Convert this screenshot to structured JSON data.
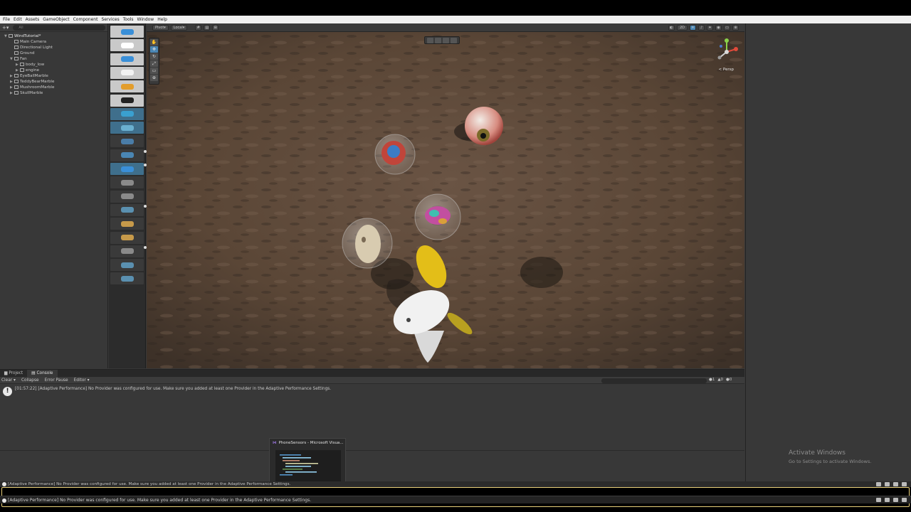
{
  "menu": [
    "File",
    "Edit",
    "Assets",
    "GameObject",
    "Component",
    "Services",
    "Tools",
    "Window",
    "Help"
  ],
  "hierarchy": {
    "search_placeholder": "All",
    "items": [
      {
        "label": "WindTutorial*",
        "depth": 0,
        "expand": "▼",
        "scene": true
      },
      {
        "label": "Main Camera",
        "depth": 1,
        "expand": ""
      },
      {
        "label": "Directional Light",
        "depth": 1,
        "expand": ""
      },
      {
        "label": "Ground",
        "depth": 1,
        "expand": ""
      },
      {
        "label": "Fan",
        "depth": 1,
        "expand": "▼"
      },
      {
        "label": "body_low",
        "depth": 2,
        "expand": "▶"
      },
      {
        "label": "engine",
        "depth": 2,
        "expand": "▶"
      },
      {
        "label": "EyeBallMarble",
        "depth": 1,
        "expand": "▶"
      },
      {
        "label": "TeddyBearMarble",
        "depth": 1,
        "expand": "▶"
      },
      {
        "label": "MushroomMarble",
        "depth": 1,
        "expand": "▶"
      },
      {
        "label": "SkullMarble",
        "depth": 1,
        "expand": "▶"
      }
    ]
  },
  "scene_toolbar": {
    "pivot_label": "Pivot",
    "local_label": "Local",
    "mode_2d_label": "2D",
    "persp_label": "< Persp"
  },
  "console": {
    "tabs": [
      "Project",
      "Console"
    ],
    "toolbar": [
      "Clear",
      "Collapse",
      "Error Pause",
      "Editor"
    ],
    "counts": [
      "1",
      "0",
      "0"
    ],
    "log_time": "[01:57:22]",
    "log_message": "[Adaptive Performance] No Provider was configured for use. Make sure you added at least one Provider in the Adaptive Performance Settings."
  },
  "taskbar_thumb": {
    "app": "PhoneSensors",
    "title_suffix": "Microsoft Visua..."
  },
  "watermark": {
    "title": "Activate Windows",
    "subtitle": "Go to Settings to activate Windows."
  },
  "status": {
    "line1": "[Adaptive Performance] No Provider was configured for use. Make sure you added at least one Provider in the Adaptive Performance Settings.",
    "line2": "[Adaptive Performance] No Provider was configured for use. Make sure you added at least one Provider in the Adaptive Performance Settings."
  },
  "colors": {
    "accent": "#4a86b4",
    "ground": "#5b4737",
    "fan_blade": "#e6c21a"
  },
  "icons": [
    "create-icon",
    "hand-tool-icon",
    "move-tool-icon",
    "rotate-tool-icon",
    "scale-tool-icon",
    "rect-tool-icon",
    "transform-tool-icon",
    "gizmo-icon",
    "info-icon",
    "warning-icon",
    "error-icon"
  ]
}
